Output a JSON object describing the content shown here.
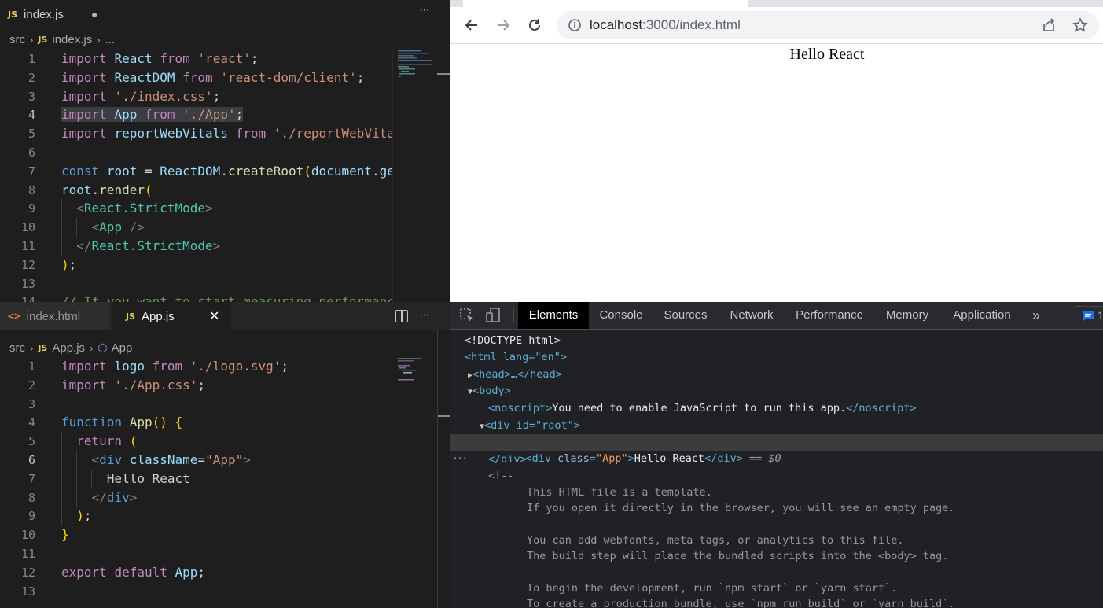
{
  "editor_top": {
    "tab": {
      "icon": "JS",
      "label": "index.js",
      "dirty_dot": "●"
    },
    "more": "···",
    "breadcrumbs": {
      "folder": "src",
      "icon": "JS",
      "file": "index.js",
      "ellipsis": "..."
    },
    "current_line": 4,
    "lines": [
      "import React from 'react';",
      "import ReactDOM from 'react-dom/client';",
      "import './index.css';",
      "import App from './App';",
      "import reportWebVitals from './reportWebVita",
      "",
      "const root = ReactDOM.createRoot(document.ge",
      "root.render(",
      "  <React.StrictMode>",
      "    <App />",
      "  </React.StrictMode>",
      ");",
      "",
      "// If you want to start measuring performanc"
    ]
  },
  "editor_bottom": {
    "tabs": [
      {
        "icon": "<>",
        "label": "index.html"
      },
      {
        "icon": "JS",
        "label": "App.js",
        "close": "✕"
      }
    ],
    "more": "···",
    "breadcrumbs": {
      "folder": "src",
      "icon": "JS",
      "file": "App.js",
      "symbol": "App"
    },
    "current_line": 6,
    "lines": [
      "import logo from './logo.svg';",
      "import './App.css';",
      "",
      "function App() {",
      "  return (",
      "    <div className=\"App\">",
      "      Hello React",
      "    </div>",
      "  );",
      "}",
      "",
      "export default App;",
      ""
    ]
  },
  "browser": {
    "url_host": "localhost",
    "url_rest": ":3000/index.html",
    "page_text": "Hello React"
  },
  "devtools": {
    "tabs": [
      "Elements",
      "Console",
      "Sources",
      "Network",
      "Performance",
      "Memory",
      "Application"
    ],
    "active_tab": "Elements",
    "overflow": "»",
    "issues_count": "1",
    "selected_marker": "== $0",
    "row_dots": "···",
    "dom": {
      "doctype": "<!DOCTYPE html>",
      "html_open": "<html lang=\"en\">",
      "head": "<head>…</head>",
      "body_open": "<body>",
      "noscript_text": "You need to enable JavaScript to run this app.",
      "root_div": "<div id=\"root\">",
      "app_div_text": "Hello React",
      "div_close": "</div>",
      "comment_open": "<!--",
      "comment_lines": [
        "This HTML file is a template.",
        "If you open it directly in the browser, you will see an empty page.",
        "",
        "You can add webfonts, meta tags, or analytics to this file.",
        "The build step will place the bundled scripts into the <body> tag.",
        "",
        "To begin the development, run `npm start` or `yarn start`.",
        "To create a production bundle, use `npm run build` or `yarn build`."
      ]
    }
  }
}
